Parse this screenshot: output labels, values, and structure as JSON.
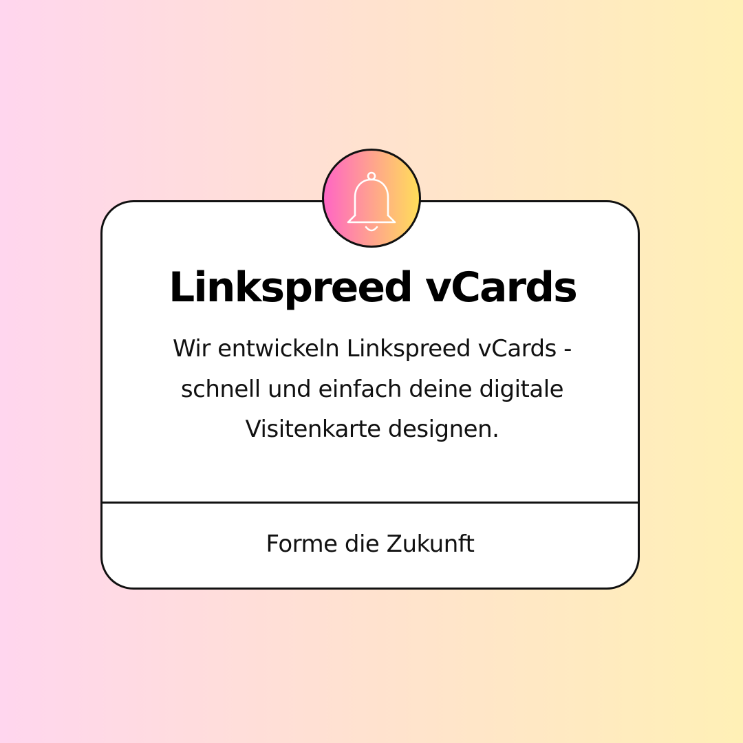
{
  "background": {
    "gradient_start": "#ffd6ee",
    "gradient_end": "#fff0b6"
  },
  "badge": {
    "icon": "bell-icon",
    "gradient_start": "#ff66c4",
    "gradient_end": "#ffde59"
  },
  "card": {
    "title": "Linkspreed vCards",
    "body": "Wir entwickeln Linkspreed vCards - schnell und einfach deine digitale Visitenkarte designen.",
    "footer": "Forme die Zukunft"
  }
}
